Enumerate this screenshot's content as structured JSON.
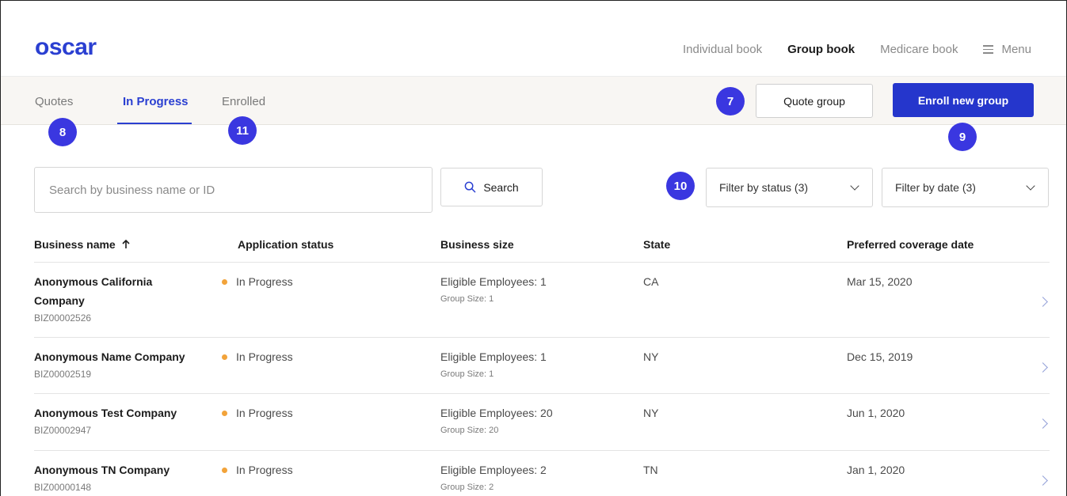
{
  "brand": {
    "logo_text": "oscar",
    "color": "#2a3fd1"
  },
  "top_nav": {
    "items": [
      "Individual book",
      "Group book",
      "Medicare book"
    ],
    "active": "Group book",
    "menu_label": "Menu"
  },
  "tabs": [
    {
      "label": "Quotes"
    },
    {
      "label": "In Progress"
    },
    {
      "label": "Enrolled"
    }
  ],
  "active_tab": "In Progress",
  "actions": {
    "quote_group": "Quote group",
    "enroll_new_group": "Enroll new group"
  },
  "annotations": {
    "quote_group": "7",
    "quotes_tab": "8",
    "enroll_new_group": "9",
    "filters": "10",
    "enrolled_tab": "11"
  },
  "search": {
    "placeholder": "Search by business name or ID",
    "button_label": "Search"
  },
  "filters": {
    "status": "Filter by status (3)",
    "date": "Filter by date (3)"
  },
  "table": {
    "columns": [
      "Business name",
      "Application status",
      "Business size",
      "State",
      "Preferred coverage date"
    ],
    "sort_column": "Business name",
    "sort_direction": "ascending",
    "rows": [
      {
        "name": "Anonymous California Company",
        "id": "BIZ00002526",
        "status": "In Progress",
        "eligible": "Eligible Employees: 1",
        "group_size": "Group Size: 1",
        "state": "CA",
        "date": "Mar 15, 2020"
      },
      {
        "name": "Anonymous Name Company",
        "id": "BIZ00002519",
        "status": "In Progress",
        "eligible": "Eligible Employees: 1",
        "group_size": "Group Size: 1",
        "state": "NY",
        "date": "Dec 15, 2019"
      },
      {
        "name": "Anonymous Test Company",
        "id": "BIZ00002947",
        "status": "In Progress",
        "eligible": "Eligible Employees: 20",
        "group_size": "Group Size: 20",
        "state": "NY",
        "date": "Jun 1, 2020"
      },
      {
        "name": "Anonymous TN Company",
        "id": "BIZ00000148",
        "status": "In Progress",
        "eligible": "Eligible Employees: 2",
        "group_size": "Group Size: 2",
        "state": "TN",
        "date": "Jan 1, 2020"
      }
    ]
  },
  "colors": {
    "primary": "#2536cc",
    "badge": "#3a37e0",
    "status_in_progress": "#f2a33a",
    "subbar_bg": "#f8f6f3"
  }
}
